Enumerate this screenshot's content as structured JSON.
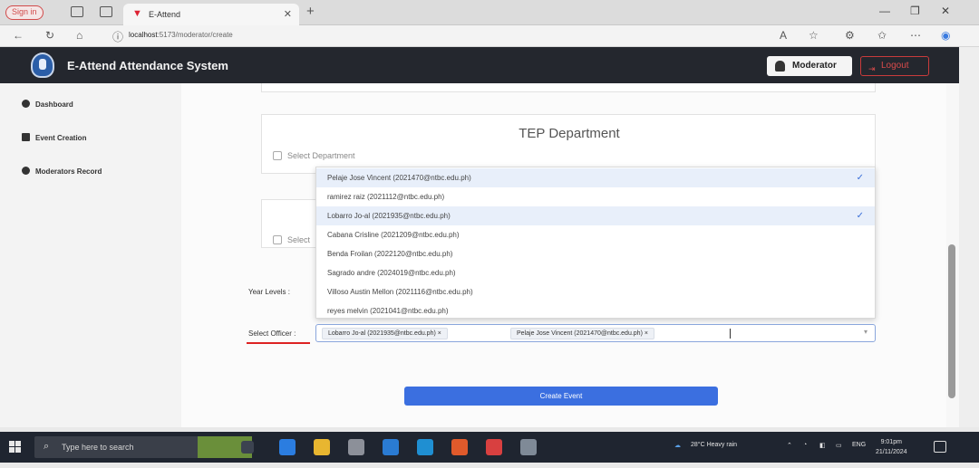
{
  "browser": {
    "signin_label": "Sign in",
    "tab_title": "E-Attend",
    "url_host": "localhost",
    "url_path": ":5173/moderator/create"
  },
  "app": {
    "title": "E-Attend Attendance System",
    "role_label": "Moderator",
    "logout_label": "Logout"
  },
  "sidebar": {
    "items": [
      {
        "label": "Dashboard",
        "icon": "dashboard-icon"
      },
      {
        "label": "Event Creation",
        "icon": "event-icon"
      },
      {
        "label": "Moderators Record",
        "icon": "users-icon"
      }
    ]
  },
  "form": {
    "department_title": "TEP Department",
    "select_department_label": "Select Department",
    "select_department_label_2": "Select",
    "year_level_label": "Year Levels :",
    "select_officer_label": "Select Officer :",
    "create_button": "Create Event"
  },
  "dropdown": {
    "options": [
      {
        "label": "Pelaje Jose Vincent (2021470@ntbc.edu.ph)",
        "selected": true
      },
      {
        "label": "ramirez raiz (2021112@ntbc.edu.ph)",
        "selected": false
      },
      {
        "label": "Lobarro Jo-al (2021935@ntbc.edu.ph)",
        "selected": true
      },
      {
        "label": "Cabana Crisline (2021209@ntbc.edu.ph)",
        "selected": false
      },
      {
        "label": "Benda Froilan (2022120@ntbc.edu.ph)",
        "selected": false
      },
      {
        "label": "Sagrado andre (2024019@ntbc.edu.ph)",
        "selected": false
      },
      {
        "label": "Villoso Austin Mellon (2021116@ntbc.edu.ph)",
        "selected": false
      },
      {
        "label": "reyes melvin (2021041@ntbc.edu.ph)",
        "selected": false
      }
    ]
  },
  "selected_officers": [
    {
      "label": "Lobarro Jo-al (2021935@ntbc.edu.ph)"
    },
    {
      "label": "Pelaje Jose Vincent (2021470@ntbc.edu.ph)"
    }
  ],
  "taskbar": {
    "search_placeholder": "Type here to search",
    "weather": "28°C  Heavy rain",
    "time": "9:01pm",
    "date": "21/11/2024",
    "lang": "ENG"
  },
  "colors": {
    "header_bg": "#24272e",
    "accent": "#3b6fe0",
    "logout": "#d84b4b",
    "selected_row": "#e8effa"
  }
}
